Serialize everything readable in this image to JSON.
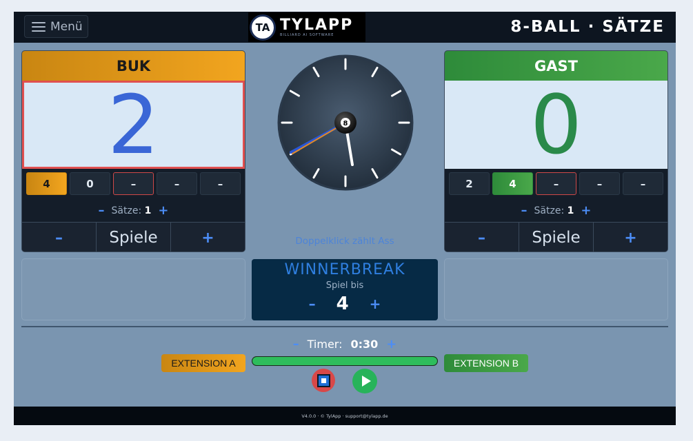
{
  "header": {
    "menu_label": "Menü",
    "logo_mark": "TA",
    "logo_text": "TYLAPP",
    "logo_sub": "BILLIARD AI SOFTWARE",
    "title": "8-BALL · SÄTZE"
  },
  "players": {
    "left": {
      "name": "BUK",
      "score": "2",
      "sets": [
        "4",
        "0",
        "–",
        "–",
        "–"
      ],
      "saetze_label": "Sätze:",
      "saetze_value": "1",
      "spiele_label": "Spiele",
      "minus": "–",
      "plus": "+"
    },
    "right": {
      "name": "GAST",
      "score": "0",
      "sets": [
        "2",
        "4",
        "–",
        "–",
        "–"
      ],
      "saetze_label": "Sätze:",
      "saetze_value": "1",
      "spiele_label": "Spiele",
      "minus": "–",
      "plus": "+"
    }
  },
  "clock": {
    "ball_number": "8",
    "hint": "Doppelklick zählt Ass"
  },
  "winnerbreak": {
    "title": "WINNERBREAK",
    "subtitle": "Spiel bis",
    "value": "4",
    "minus": "–",
    "plus": "+"
  },
  "timer": {
    "label": "Timer:",
    "value": "0:30",
    "minus": "–",
    "plus": "+",
    "progress": 1.0,
    "extension_a": "EXTENSION A",
    "extension_b": "EXTENSION B"
  },
  "footer": {
    "text": "V4.0.0 · © TylApp · support@tylapp.de"
  },
  "colors": {
    "accent_orange": "#f2a51f",
    "accent_green": "#4aa84a",
    "link_blue": "#4c8df6"
  }
}
